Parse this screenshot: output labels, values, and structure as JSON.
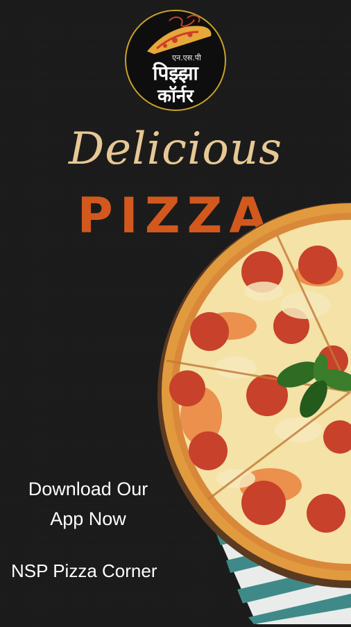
{
  "logo": {
    "small_text": "एन.एस.पी",
    "line1": "पिझ्झा",
    "line2": "कॉर्नर",
    "ring_color": "#c9a227"
  },
  "headline": {
    "script": "Delicious",
    "main": "PIZZA",
    "script_color": "#e7c894",
    "main_color": "#d2581e"
  },
  "cta": {
    "line1": "Download Our",
    "line2": "App Now"
  },
  "brand_name": "NSP Pizza Corner",
  "colors": {
    "background": "#1b1b1b",
    "crust": "#e29a3e",
    "cheese": "#f4e2a7",
    "pepperoni": "#c8412a",
    "basil": "#2f6b23",
    "towel_stripe": "#3f8a88"
  }
}
